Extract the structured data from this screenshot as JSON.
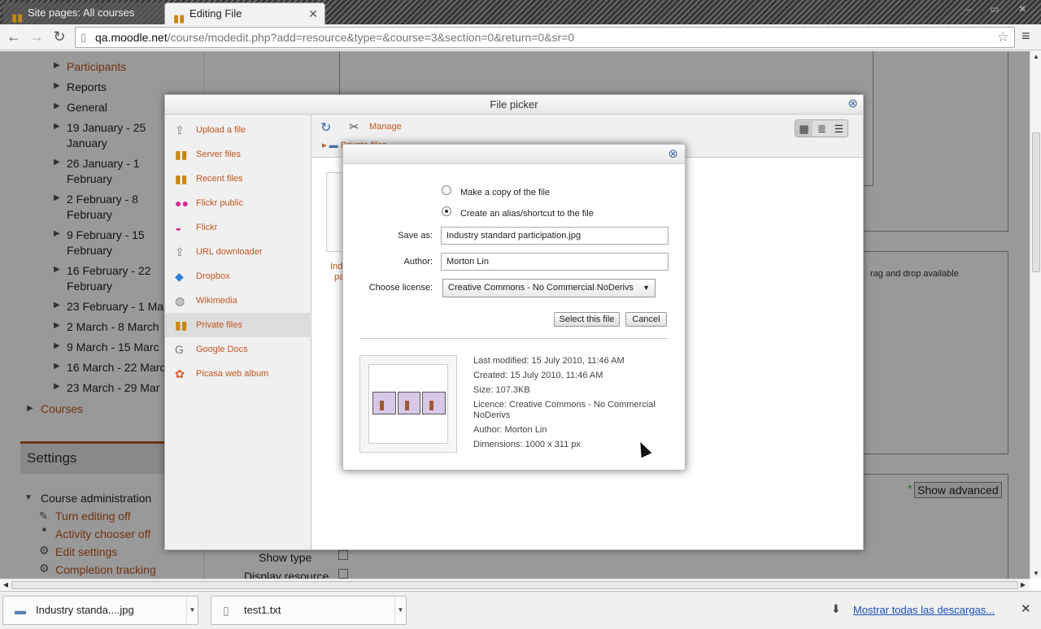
{
  "browser": {
    "tabs": [
      {
        "label": "Site pages: All courses",
        "active": false
      },
      {
        "label": "Editing File",
        "active": true
      }
    ],
    "url_host": "qa.moodle.net",
    "url_path": "/course/modedit.php?add=resource&type=&course=3&section=0&return=0&sr=0"
  },
  "nav": {
    "items": [
      {
        "label": "Participants",
        "link": true
      },
      {
        "label": "Reports",
        "link": false
      },
      {
        "label": "General",
        "link": false
      },
      {
        "label": "19 January - 25 January",
        "link": false
      },
      {
        "label": "26 January - 1 February",
        "link": false
      },
      {
        "label": "2 February - 8 February",
        "link": false
      },
      {
        "label": "9 February - 15 February",
        "link": false
      },
      {
        "label": "16 February - 22 February",
        "link": false
      },
      {
        "label": "23 February - 1 Ma",
        "link": false
      },
      {
        "label": "2 March - 8 March",
        "link": false
      },
      {
        "label": "9 March - 15 Marc",
        "link": false
      },
      {
        "label": "16 March - 22 Marc",
        "link": false
      },
      {
        "label": "23 March - 29 Mar",
        "link": false
      }
    ],
    "courses": "Courses"
  },
  "settings": {
    "title": "Settings",
    "course_admin": "Course administration",
    "items": [
      "Turn editing off",
      "Activity chooser off",
      "Edit settings",
      "Completion tracking"
    ]
  },
  "form": {
    "show_advanced": "Show advanced",
    "drag_drop": "rag and drop available",
    "show_type": "Show type",
    "display_resource": "Display resource"
  },
  "file_picker": {
    "title": "File picker",
    "repositories": [
      {
        "label": "Upload a file",
        "icon": "upload-icon"
      },
      {
        "label": "Server files",
        "icon": "moodle-icon"
      },
      {
        "label": "Recent files",
        "icon": "moodle-icon"
      },
      {
        "label": "Flickr public",
        "icon": "flickr-icon"
      },
      {
        "label": "Flickr",
        "icon": "flickr-icon"
      },
      {
        "label": "URL downloader",
        "icon": "url-icon"
      },
      {
        "label": "Dropbox",
        "icon": "dropbox-icon"
      },
      {
        "label": "Wikimedia",
        "icon": "wikimedia-icon"
      },
      {
        "label": "Private files",
        "icon": "moodle-icon"
      },
      {
        "label": "Google Docs",
        "icon": "google-icon"
      },
      {
        "label": "Picasa web album",
        "icon": "picasa-icon"
      }
    ],
    "manage": "Manage",
    "breadcrumb": "Private files",
    "file_label_1": "Ind",
    "file_label_2": "pa"
  },
  "select_dialog": {
    "option_copy": "Make a copy of the file",
    "option_alias": "Create an alias/shortcut to the file",
    "save_as_label": "Save as:",
    "save_as_value": "Industry standard participation.jpg",
    "author_label": "Author:",
    "author_value": "Morton Lin",
    "license_label": "Choose license:",
    "license_value": "Creative Commons - No Commercial NoDerivs",
    "select_button": "Select this file",
    "cancel_button": "Cancel",
    "info": {
      "last_modified": "Last modified: 15 July 2010, 11:46 AM",
      "created": "Created: 15 July 2010, 11:46 AM",
      "size": "Size: 107.3KB",
      "licence": "Licence: Creative Commons - No Commercial NoDerivs",
      "author": "Author: Morton Lin",
      "dimensions": "Dimensions: 1000 x 311 px"
    }
  },
  "downloads": {
    "items": [
      "Industry standa....jpg",
      "test1.txt"
    ],
    "show_all": "Mostrar todas las descargas..."
  },
  "colors": {
    "link": "#c0561f",
    "accent_blue": "#4a6ea8"
  }
}
